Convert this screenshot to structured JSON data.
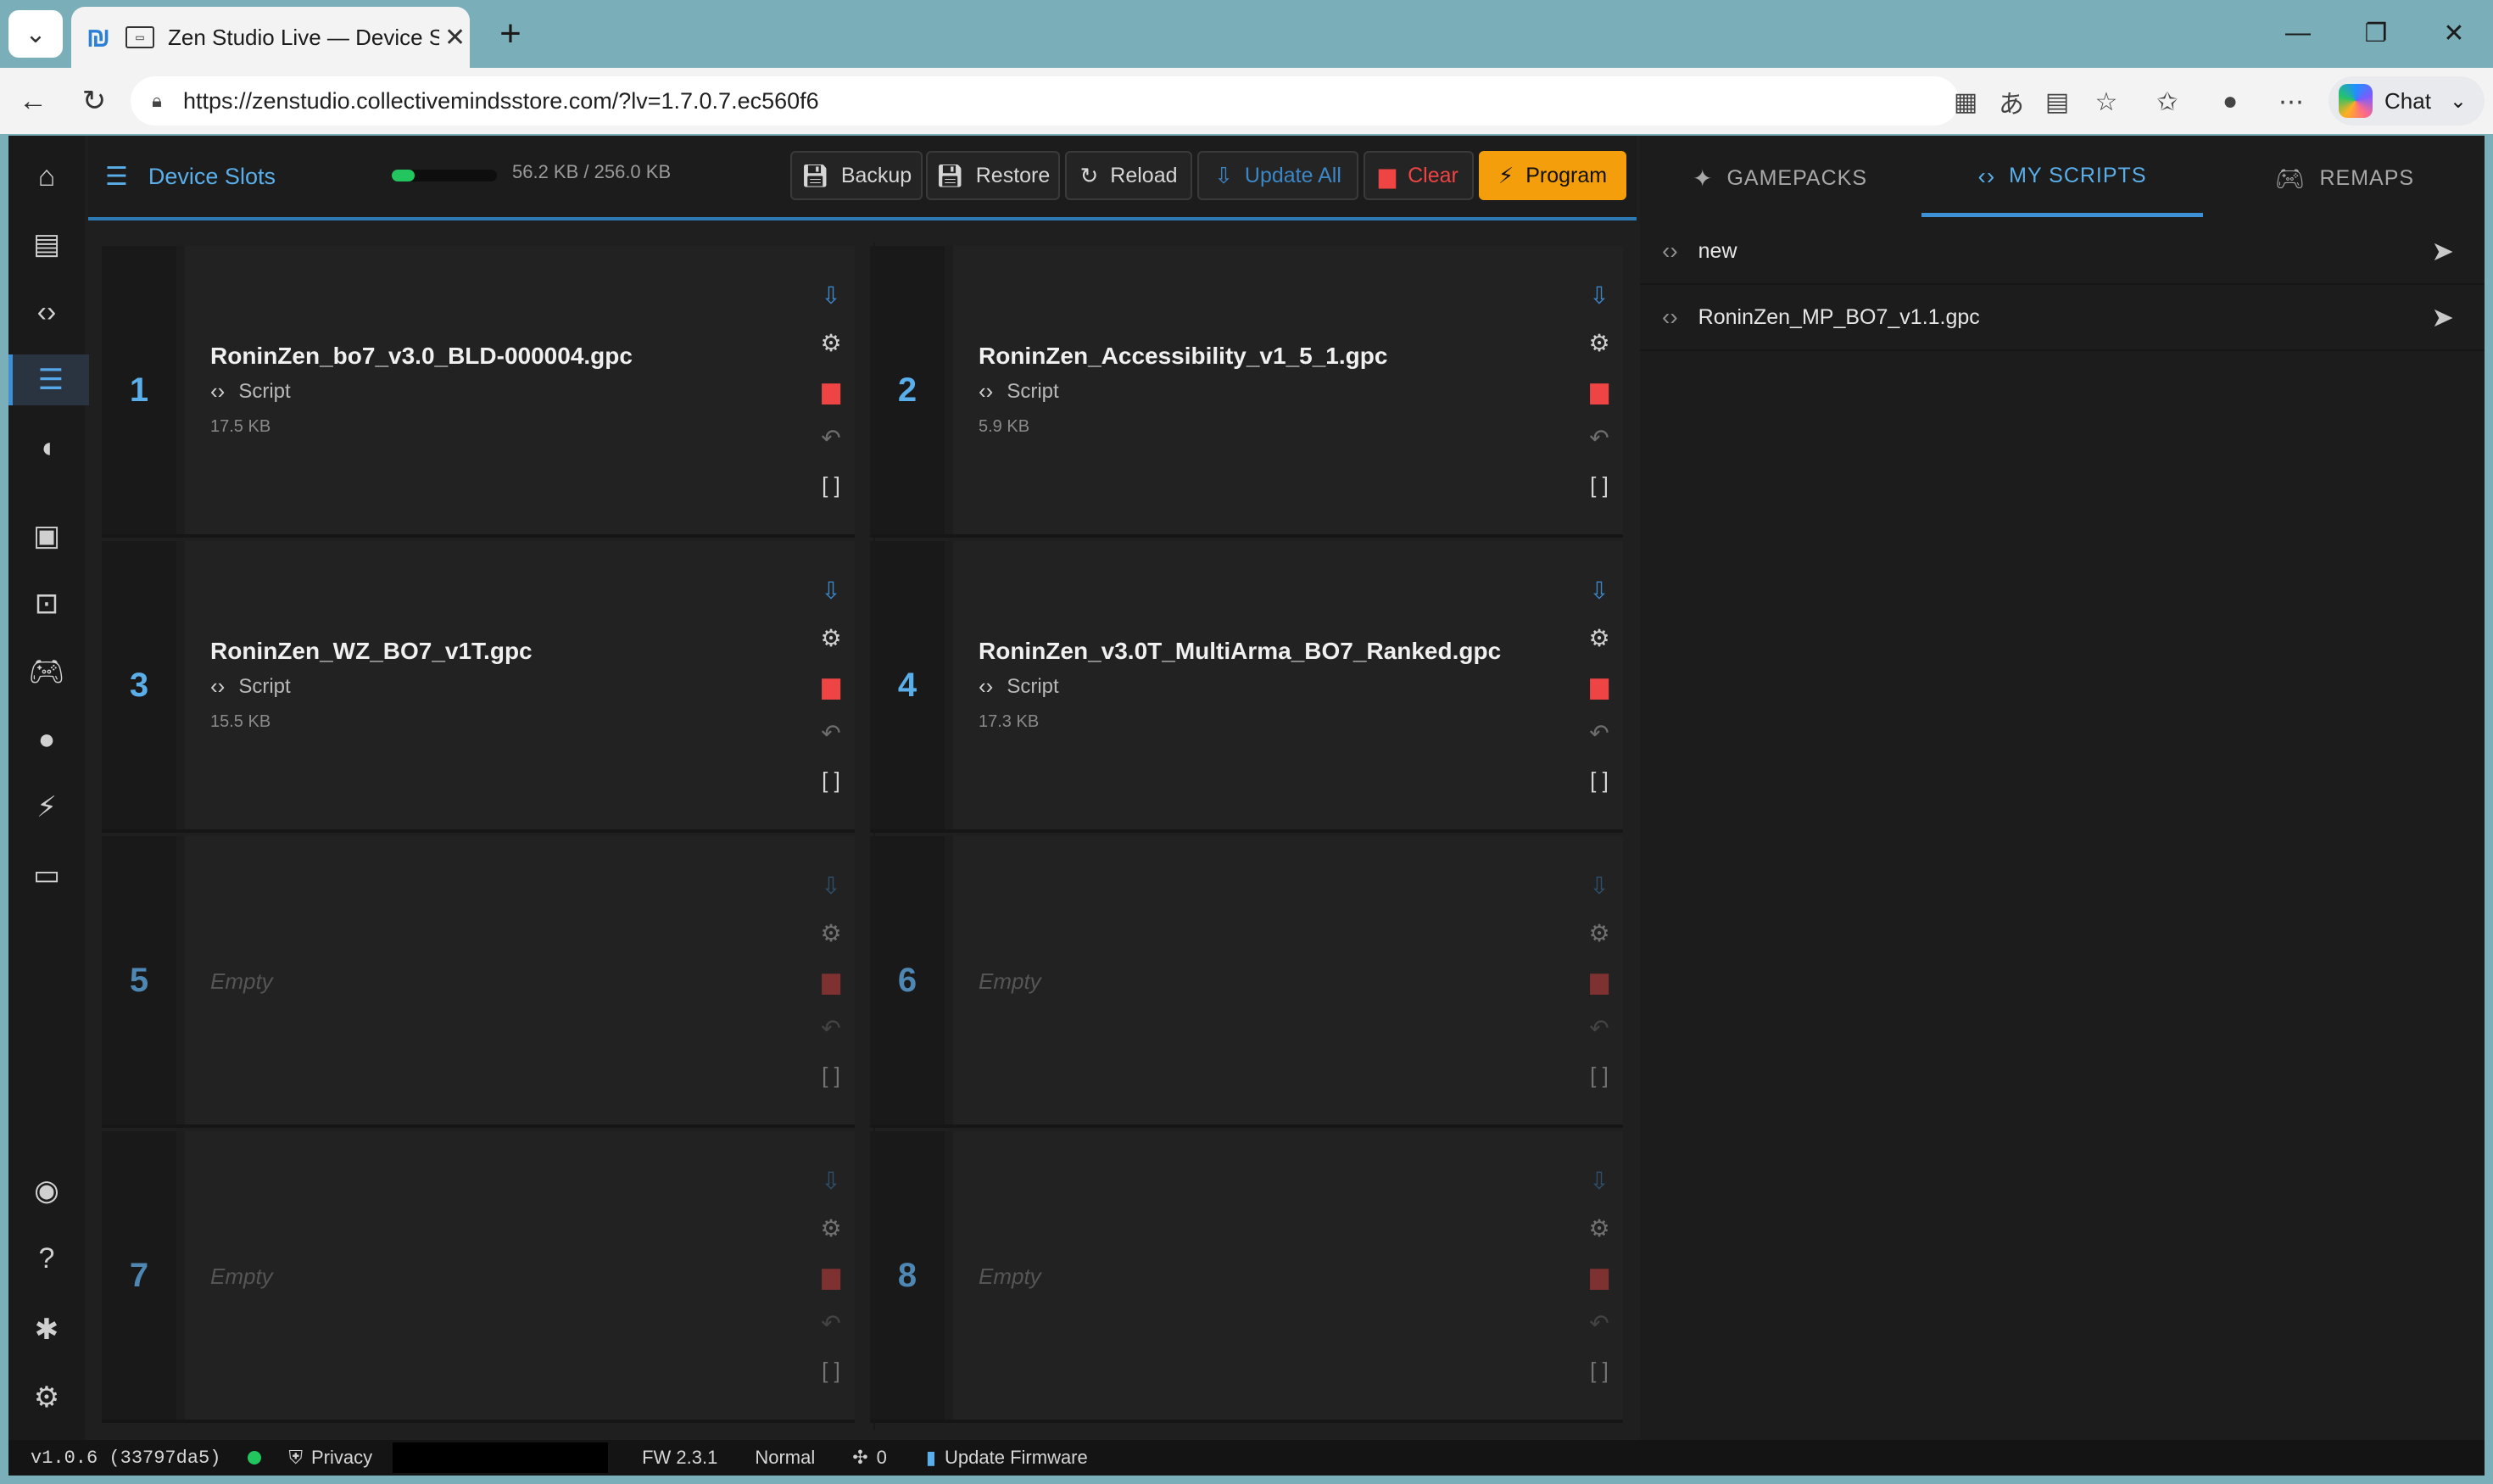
{
  "browser": {
    "tab_title": "Zen Studio Live — Device Slots",
    "url": "https://zenstudio.collectivemindsstore.com/?lv=1.7.0.7.ec560f6",
    "chat_label": "Chat",
    "new_tab_glyph": "+",
    "min_glyph": "—",
    "max_glyph": "❐",
    "close_glyph": "✕"
  },
  "app": {
    "title": "Device Slots",
    "memory_text": "56.2 KB / 256.0 KB",
    "memory_used_fraction": 0.22,
    "toolbar": {
      "backup": "Backup",
      "restore": "Restore",
      "reload": "Reload",
      "update_all": "Update All",
      "clear": "Clear",
      "program": "Program"
    }
  },
  "slots": [
    {
      "num": "1",
      "name": "RoninZen_bo7_v3.0_BLD-000004.gpc",
      "type": "Script",
      "size": "17.5 KB"
    },
    {
      "num": "2",
      "name": "RoninZen_Accessibility_v1_5_1.gpc",
      "type": "Script",
      "size": "5.9 KB"
    },
    {
      "num": "3",
      "name": "RoninZen_WZ_BO7_v1T.gpc",
      "type": "Script",
      "size": "15.5 KB"
    },
    {
      "num": "4",
      "name": "RoninZen_v3.0T_MultiArma_BO7_Ranked.gpc",
      "type": "Script",
      "size": "17.3 KB"
    },
    {
      "num": "5",
      "empty": "Empty"
    },
    {
      "num": "6",
      "empty": "Empty"
    },
    {
      "num": "7",
      "empty": "Empty"
    },
    {
      "num": "8",
      "empty": "Empty"
    }
  ],
  "right_panel": {
    "tabs": [
      {
        "label": "GAMEPACKS"
      },
      {
        "label": "MY SCRIPTS",
        "active": true
      },
      {
        "label": "REMAPS"
      }
    ],
    "items": [
      {
        "label": "new"
      },
      {
        "label": "RoninZen_MP_BO7_v1.1.gpc"
      }
    ]
  },
  "status": {
    "version": "v1.0.6 (33797da5)",
    "privacy": "Privacy",
    "fw": "FW 2.3.1",
    "mode": "Normal",
    "count": "0",
    "update_firmware": "Update Firmware"
  },
  "colors": {
    "accent": "#3d8fd6",
    "danger": "#ef4444",
    "program": "#f59e0b",
    "ok": "#22c55e"
  }
}
